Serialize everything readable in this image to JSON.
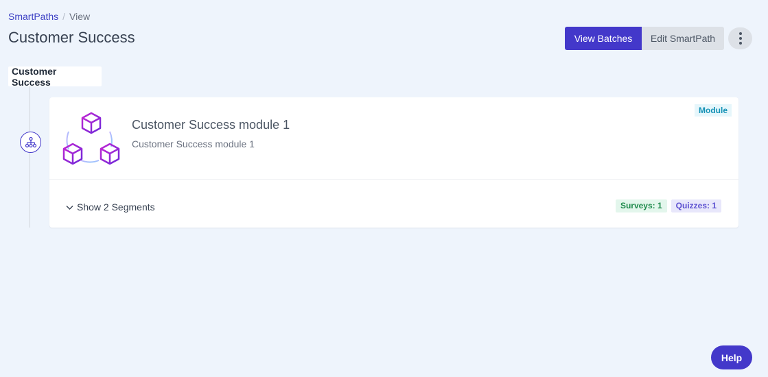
{
  "breadcrumb": {
    "parent": "SmartPaths",
    "separator": "/",
    "current": "View"
  },
  "page_title": "Customer Success",
  "actions": {
    "view_batches": "View Batches",
    "edit_smartpath": "Edit SmartPath",
    "more_icon": "vertical-dots-icon"
  },
  "path_label": "Customer Success",
  "module": {
    "title": "Customer Success module 1",
    "subtitle": "Customer Success module 1",
    "badge": "Module",
    "toggle": "Show 2 Segments",
    "stats": {
      "surveys": "Surveys: 1",
      "quizzes": "Quizzes: 1"
    }
  },
  "help": "Help",
  "colors": {
    "primary": "#4338ca",
    "background": "#eef4fc",
    "badge_module": "#1592b6",
    "surveys": "#1f8a4c",
    "quizzes": "#5b4fd0"
  }
}
